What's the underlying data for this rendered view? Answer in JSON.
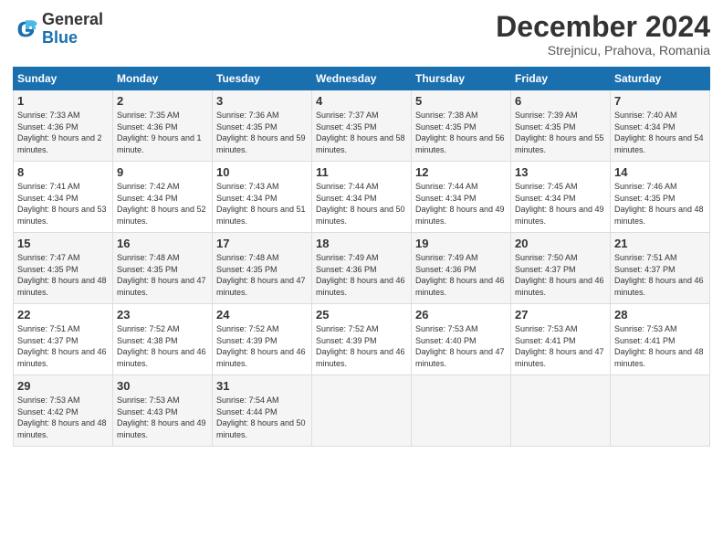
{
  "header": {
    "logo_general": "General",
    "logo_blue": "Blue",
    "month_title": "December 2024",
    "subtitle": "Strejnicu, Prahova, Romania"
  },
  "days_of_week": [
    "Sunday",
    "Monday",
    "Tuesday",
    "Wednesday",
    "Thursday",
    "Friday",
    "Saturday"
  ],
  "weeks": [
    [
      {
        "day": "1",
        "sunrise": "Sunrise: 7:33 AM",
        "sunset": "Sunset: 4:36 PM",
        "daylight": "Daylight: 9 hours and 2 minutes."
      },
      {
        "day": "2",
        "sunrise": "Sunrise: 7:35 AM",
        "sunset": "Sunset: 4:36 PM",
        "daylight": "Daylight: 9 hours and 1 minute."
      },
      {
        "day": "3",
        "sunrise": "Sunrise: 7:36 AM",
        "sunset": "Sunset: 4:35 PM",
        "daylight": "Daylight: 8 hours and 59 minutes."
      },
      {
        "day": "4",
        "sunrise": "Sunrise: 7:37 AM",
        "sunset": "Sunset: 4:35 PM",
        "daylight": "Daylight: 8 hours and 58 minutes."
      },
      {
        "day": "5",
        "sunrise": "Sunrise: 7:38 AM",
        "sunset": "Sunset: 4:35 PM",
        "daylight": "Daylight: 8 hours and 56 minutes."
      },
      {
        "day": "6",
        "sunrise": "Sunrise: 7:39 AM",
        "sunset": "Sunset: 4:35 PM",
        "daylight": "Daylight: 8 hours and 55 minutes."
      },
      {
        "day": "7",
        "sunrise": "Sunrise: 7:40 AM",
        "sunset": "Sunset: 4:34 PM",
        "daylight": "Daylight: 8 hours and 54 minutes."
      }
    ],
    [
      {
        "day": "8",
        "sunrise": "Sunrise: 7:41 AM",
        "sunset": "Sunset: 4:34 PM",
        "daylight": "Daylight: 8 hours and 53 minutes."
      },
      {
        "day": "9",
        "sunrise": "Sunrise: 7:42 AM",
        "sunset": "Sunset: 4:34 PM",
        "daylight": "Daylight: 8 hours and 52 minutes."
      },
      {
        "day": "10",
        "sunrise": "Sunrise: 7:43 AM",
        "sunset": "Sunset: 4:34 PM",
        "daylight": "Daylight: 8 hours and 51 minutes."
      },
      {
        "day": "11",
        "sunrise": "Sunrise: 7:44 AM",
        "sunset": "Sunset: 4:34 PM",
        "daylight": "Daylight: 8 hours and 50 minutes."
      },
      {
        "day": "12",
        "sunrise": "Sunrise: 7:44 AM",
        "sunset": "Sunset: 4:34 PM",
        "daylight": "Daylight: 8 hours and 49 minutes."
      },
      {
        "day": "13",
        "sunrise": "Sunrise: 7:45 AM",
        "sunset": "Sunset: 4:34 PM",
        "daylight": "Daylight: 8 hours and 49 minutes."
      },
      {
        "day": "14",
        "sunrise": "Sunrise: 7:46 AM",
        "sunset": "Sunset: 4:35 PM",
        "daylight": "Daylight: 8 hours and 48 minutes."
      }
    ],
    [
      {
        "day": "15",
        "sunrise": "Sunrise: 7:47 AM",
        "sunset": "Sunset: 4:35 PM",
        "daylight": "Daylight: 8 hours and 48 minutes."
      },
      {
        "day": "16",
        "sunrise": "Sunrise: 7:48 AM",
        "sunset": "Sunset: 4:35 PM",
        "daylight": "Daylight: 8 hours and 47 minutes."
      },
      {
        "day": "17",
        "sunrise": "Sunrise: 7:48 AM",
        "sunset": "Sunset: 4:35 PM",
        "daylight": "Daylight: 8 hours and 47 minutes."
      },
      {
        "day": "18",
        "sunrise": "Sunrise: 7:49 AM",
        "sunset": "Sunset: 4:36 PM",
        "daylight": "Daylight: 8 hours and 46 minutes."
      },
      {
        "day": "19",
        "sunrise": "Sunrise: 7:49 AM",
        "sunset": "Sunset: 4:36 PM",
        "daylight": "Daylight: 8 hours and 46 minutes."
      },
      {
        "day": "20",
        "sunrise": "Sunrise: 7:50 AM",
        "sunset": "Sunset: 4:37 PM",
        "daylight": "Daylight: 8 hours and 46 minutes."
      },
      {
        "day": "21",
        "sunrise": "Sunrise: 7:51 AM",
        "sunset": "Sunset: 4:37 PM",
        "daylight": "Daylight: 8 hours and 46 minutes."
      }
    ],
    [
      {
        "day": "22",
        "sunrise": "Sunrise: 7:51 AM",
        "sunset": "Sunset: 4:37 PM",
        "daylight": "Daylight: 8 hours and 46 minutes."
      },
      {
        "day": "23",
        "sunrise": "Sunrise: 7:52 AM",
        "sunset": "Sunset: 4:38 PM",
        "daylight": "Daylight: 8 hours and 46 minutes."
      },
      {
        "day": "24",
        "sunrise": "Sunrise: 7:52 AM",
        "sunset": "Sunset: 4:39 PM",
        "daylight": "Daylight: 8 hours and 46 minutes."
      },
      {
        "day": "25",
        "sunrise": "Sunrise: 7:52 AM",
        "sunset": "Sunset: 4:39 PM",
        "daylight": "Daylight: 8 hours and 46 minutes."
      },
      {
        "day": "26",
        "sunrise": "Sunrise: 7:53 AM",
        "sunset": "Sunset: 4:40 PM",
        "daylight": "Daylight: 8 hours and 47 minutes."
      },
      {
        "day": "27",
        "sunrise": "Sunrise: 7:53 AM",
        "sunset": "Sunset: 4:41 PM",
        "daylight": "Daylight: 8 hours and 47 minutes."
      },
      {
        "day": "28",
        "sunrise": "Sunrise: 7:53 AM",
        "sunset": "Sunset: 4:41 PM",
        "daylight": "Daylight: 8 hours and 48 minutes."
      }
    ],
    [
      {
        "day": "29",
        "sunrise": "Sunrise: 7:53 AM",
        "sunset": "Sunset: 4:42 PM",
        "daylight": "Daylight: 8 hours and 48 minutes."
      },
      {
        "day": "30",
        "sunrise": "Sunrise: 7:53 AM",
        "sunset": "Sunset: 4:43 PM",
        "daylight": "Daylight: 8 hours and 49 minutes."
      },
      {
        "day": "31",
        "sunrise": "Sunrise: 7:54 AM",
        "sunset": "Sunset: 4:44 PM",
        "daylight": "Daylight: 8 hours and 50 minutes."
      },
      null,
      null,
      null,
      null
    ]
  ]
}
